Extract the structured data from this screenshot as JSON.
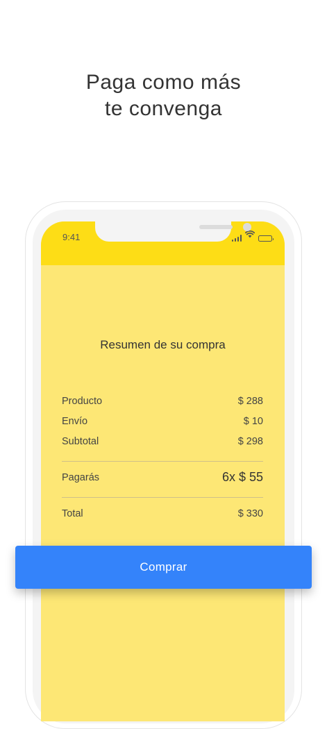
{
  "headline": {
    "line1": "Paga como más",
    "line2": "te convenga"
  },
  "status_bar": {
    "time": "9:41"
  },
  "summary": {
    "title": "Resumen de su compra",
    "rows": [
      {
        "label": "Producto",
        "value": "$ 288"
      },
      {
        "label": "Envío",
        "value": "$ 10"
      },
      {
        "label": "Subtotal",
        "value": "$ 298"
      }
    ],
    "installments": {
      "label": "Pagarás",
      "value": "6x $ 55"
    },
    "total": {
      "label": "Total",
      "value": "$ 330"
    }
  },
  "cta": {
    "label": "Comprar"
  },
  "colors": {
    "status_yellow": "#fddd16",
    "screen_yellow": "#fde775",
    "button_blue": "#3483fa"
  },
  "icons": [
    "cellular-signal-icon",
    "wifi-icon",
    "battery-icon"
  ]
}
